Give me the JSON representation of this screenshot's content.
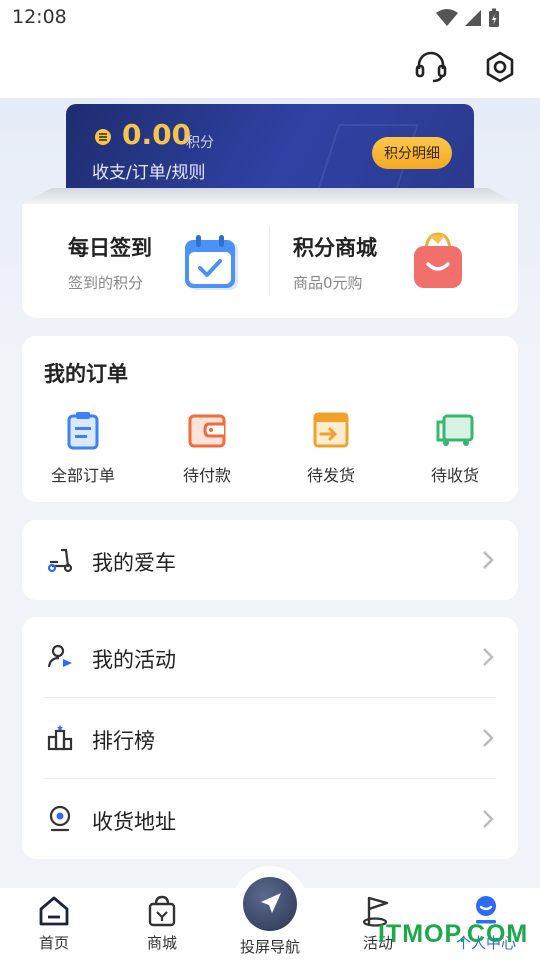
{
  "status_bar": {
    "time": "12:08"
  },
  "points_card": {
    "value": "0.00",
    "unit": "积分",
    "links": "收支/订单/规则",
    "detail_button": "积分明细"
  },
  "features": [
    {
      "title": "每日签到",
      "subtitle": "签到的积分",
      "icon": "calendar-check-icon"
    },
    {
      "title": "积分商城",
      "subtitle": "商品0元购",
      "icon": "shopping-bag-icon"
    }
  ],
  "orders": {
    "title": "我的订单",
    "items": [
      {
        "label": "全部订单",
        "icon": "clipboard-icon"
      },
      {
        "label": "待付款",
        "icon": "wallet-icon"
      },
      {
        "label": "待发货",
        "icon": "package-out-icon"
      },
      {
        "label": "待收货",
        "icon": "truck-icon"
      }
    ]
  },
  "menu": {
    "my_car": "我的爱车",
    "my_activities": "我的活动",
    "leaderboard": "排行榜",
    "address": "收货地址"
  },
  "tab_bar": {
    "home": "首页",
    "mall": "商城",
    "navigation": "投屏导航",
    "activity": "活动",
    "profile": "个人中心"
  },
  "watermark": "ITMOP.COM",
  "colors": {
    "accent_blue": "#2d6cf2",
    "gold": "#f5c44a",
    "card_navy": "#243580"
  }
}
